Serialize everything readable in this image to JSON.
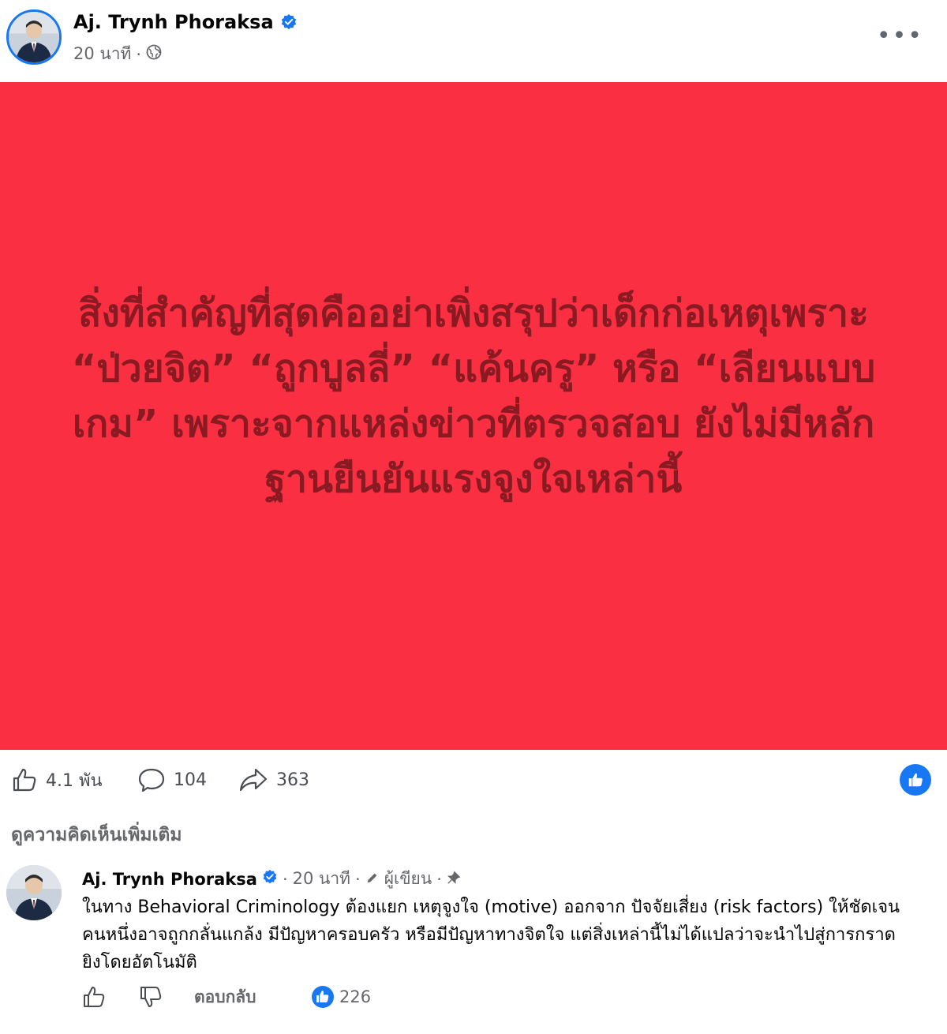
{
  "post": {
    "author": "Aj. Trynh Phoraksa",
    "time": "20 นาที",
    "privacy_icon": "globe-icon",
    "separator": "·",
    "more_icon": "more-dots-icon",
    "more_label": "•••",
    "card_text": "สิ่งที่สำคัญที่สุดคืออย่าเพิ่งสรุปว่าเด็กก่อเหตุเพราะ “ป่วยจิต” “ถูกบูลลี่” “แค้นครู” หรือ “เลียนแบบเกม” เพราะจากแหล่งข่าวที่ตรวจสอบ ยังไม่มีหลักฐานยืนยันแรงจูงใจเหล่านี้",
    "card_bg": "#fb2f42",
    "card_text_color": "#8a1a22"
  },
  "stats": {
    "likes": "4.1 พัน",
    "comments": "104",
    "shares": "363"
  },
  "see_more_comments": "ดูความคิดเห็นเพิ่มเติม",
  "comment": {
    "author": "Aj. Trynh Phoraksa",
    "time": "20 นาที",
    "role": "ผู้เขียน",
    "separator": "·",
    "text": "ในทาง Behavioral Criminology ต้องแยก เหตุจูงใจ (motive) ออกจาก ปัจจัยเสี่ยง (risk factors) ให้ชัดเจน คนหนึ่งอาจถูกกลั่นแกล้ง มีปัญหาครอบครัว หรือมีปัญหาทางจิตใจ แต่สิ่งเหล่านี้ไม่ได้แปลว่าจะนำไปสู่การกราดยิงโดยอัตโนมัติ",
    "reply_label": "ตอบกลับ",
    "reaction_count": "226"
  },
  "colors": {
    "accent": "#1877f2",
    "secondary_text": "#65676b"
  }
}
